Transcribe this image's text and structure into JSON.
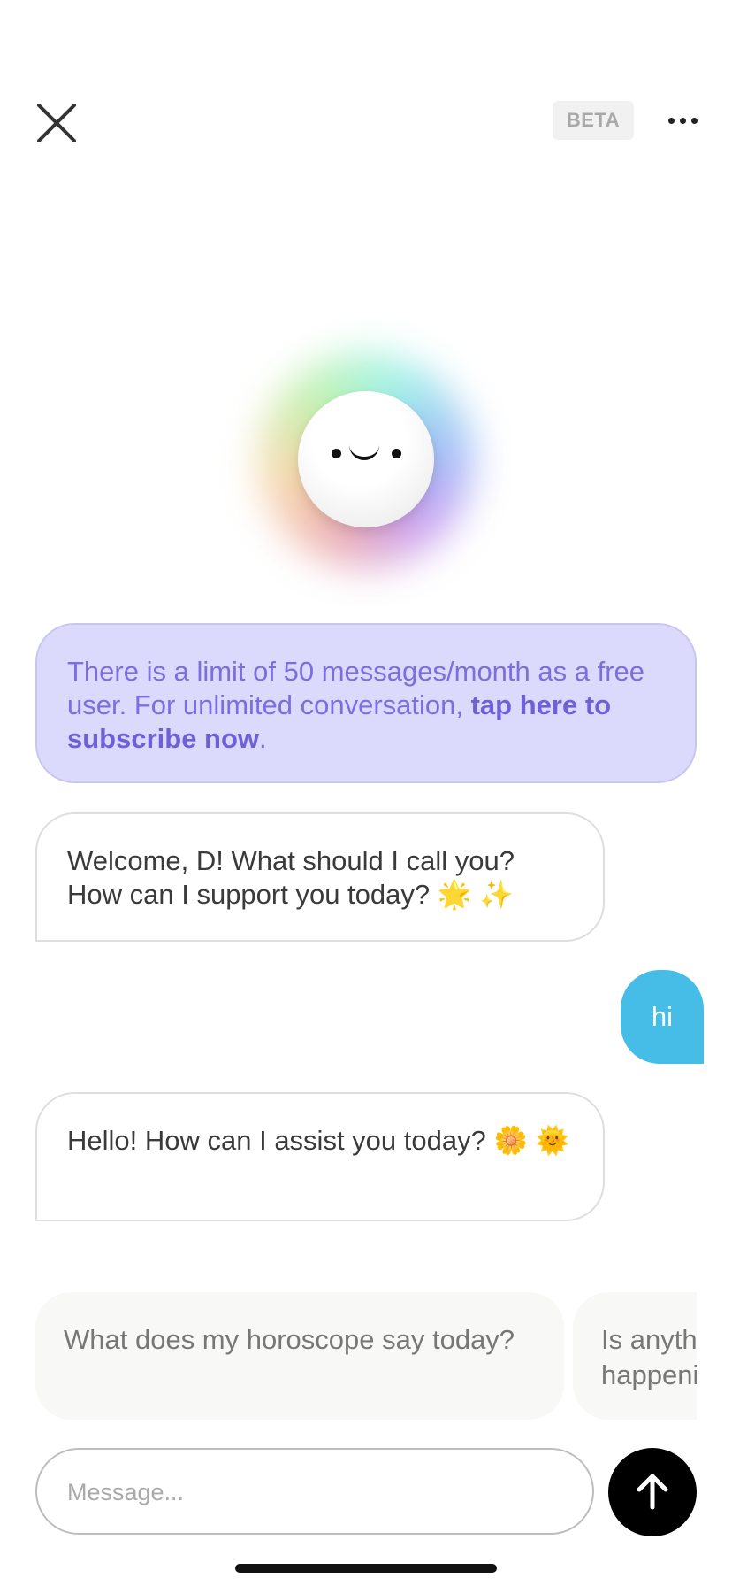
{
  "header": {
    "close_icon": "close-x-icon",
    "beta_label": "BETA",
    "more_icon": "ellipsis-icon"
  },
  "avatar": {
    "icon": "smiling-orb-avatar"
  },
  "messages": [
    {
      "role": "notice",
      "text_before": "There is a limit of 50 messages/month as a free user. For unlimited conversation, ",
      "link_text": "tap here to subscribe now",
      "text_after": "."
    },
    {
      "role": "assistant",
      "text": "Welcome, D! What should I call you? How can I support you today? 🌟 ✨"
    },
    {
      "role": "user",
      "text": "hi"
    },
    {
      "role": "assistant",
      "text": "Hello! How can I assist you today? 🌼 🌞"
    }
  ],
  "suggestions": [
    "What does my horoscope say today?",
    "Is anything happening"
  ],
  "composer": {
    "placeholder": "Message...",
    "send_icon": "arrow-up-icon"
  },
  "colors": {
    "notice_bg": "#dcdafc",
    "notice_text": "#7a6ee0",
    "user_bubble": "#45bde6",
    "send_button": "#000000"
  }
}
